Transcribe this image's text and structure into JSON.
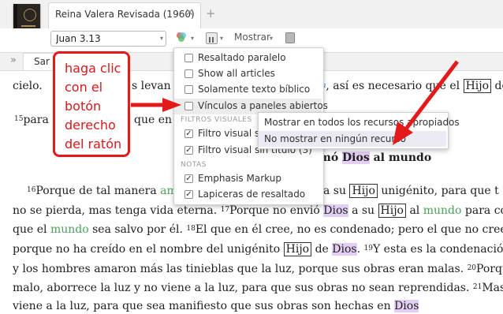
{
  "tab": {
    "title": "Reina Valera Revisada (1960)",
    "close": "✕",
    "add": "+"
  },
  "toolbar": {
    "reference": "Juan 3.13",
    "mostrar": "Mostrar",
    "dropdown": "▾"
  },
  "strip": {
    "chevron": "»",
    "tab_label": "Sar"
  },
  "bible": {
    "l1_a": "cielo.",
    "l1_b": "s levan",
    "l1_c": ", así es necesario que el",
    "l1_hijo": "Hijo",
    "l1_d": "de",
    "l1_note": "a",
    "l2_num": "15",
    "l2_a": "para",
    "l2_b": "que en",
    "heading_a": "mó",
    "heading_dios": "Dios",
    "heading_b": "al mundo",
    "v16_num": "16",
    "v16_a": "Porque de tal manera",
    "v16_amo": "am",
    "v16_b": "a su",
    "v16_hijo": "Hijo",
    "v16_c": "unigénito, para que t",
    "l4_a": "no se pierda, mas tenga vida eterna.",
    "v17_num": "17",
    "l4_b": "Porque no envió",
    "l4_dios": "Dios",
    "l4_c": "a su",
    "l4_hijo": "Hijo",
    "l4_d": "al",
    "l4_mundo": "mundo",
    "l4_e": "para conde",
    "l5_a": "que el",
    "l5_mundo": "mundo",
    "l5_b": "sea salvo por él.",
    "v18_num": "18",
    "l5_c": "El que en él cree, no es condenado; pero el que no cree",
    "l6_a": "porque no ha creído en el nombre del unigénito",
    "l6_hijo": "Hijo",
    "l6_b": "de",
    "l6_dios": "Dios",
    "v19_num": "19",
    "l6_c": "Y esta es la condenación: q",
    "l7_a": "y los hombres amaron más las tinieblas que la luz, porque sus obras eran malas.",
    "v20_num": "20",
    "l7_b": "Porqu",
    "l8_a": "malo, aborrece la luz y no viene a la luz, para que sus obras no sean reprendidas.",
    "v21_num": "21",
    "l8_b": "Mas",
    "l9_a": "viene a la luz, para que sea manifiesto que sus obras son hechas en",
    "l9_dios": "Dios"
  },
  "menu": {
    "items": [
      {
        "label": "Resaltado paralelo",
        "checked": false
      },
      {
        "label": "Show all articles",
        "checked": false
      },
      {
        "label": "Solamente texto bíblico",
        "checked": false
      },
      {
        "label": "Vínculos a paneles abiertos",
        "checked": false
      }
    ],
    "section_filters": "FILTROS VISUALES",
    "filters": [
      {
        "label": "Filtro visual sin",
        "checked": true
      },
      {
        "label": "Filtro visual sin título (3)",
        "checked": true
      }
    ],
    "section_notes": "NOTAS",
    "notes": [
      {
        "label": "Emphasis Markup",
        "checked": true
      },
      {
        "label": "Lapiceras de resaltado",
        "checked": true
      }
    ],
    "check_glyph": "✓"
  },
  "submenu": {
    "items": [
      {
        "label": "Mostrar en todos los recursos apropiados"
      },
      {
        "label": "No mostrar en ningún recurso"
      }
    ]
  },
  "callout": {
    "lines": [
      "haga clic",
      "con el",
      "botón",
      "derecho",
      "del ratón"
    ]
  },
  "colors": {
    "callout_red": "#e3191c",
    "dios_highlight": "#e3cff3",
    "mundo_green": "#4ba15a"
  }
}
